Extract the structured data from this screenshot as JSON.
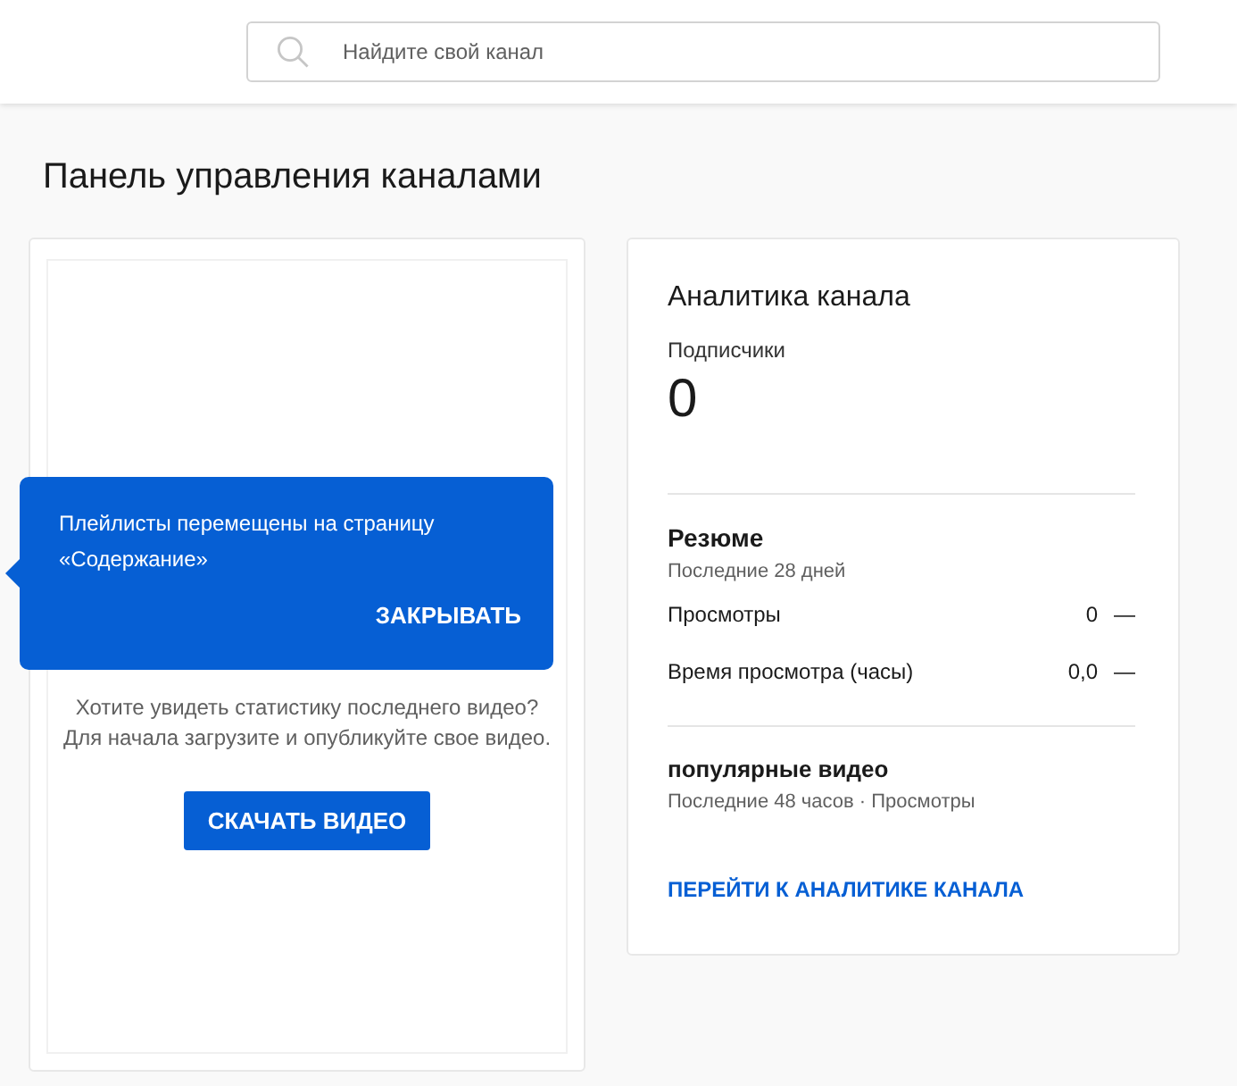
{
  "search": {
    "placeholder": "Найдите свой канал"
  },
  "page_title": "Панель управления каналами",
  "video_card": {
    "tooltip": {
      "text": "Плейлисты перемещены на страницу «Содержание»",
      "close_label": "ЗАКРЫВАТЬ"
    },
    "message_lines": [
      "Хотите увидеть статистику последнего видео?",
      "Для начала загрузите и опубликуйте свое видео."
    ],
    "button": "СКАЧАТЬ ВИДЕО"
  },
  "analytics": {
    "title": "Аналитика канала",
    "subscribers_label": "Подписчики",
    "subscribers_value": "0",
    "summary": {
      "title": "Резюме",
      "period": "Последние 28 дней",
      "metrics": [
        {
          "label": "Просмотры",
          "value": "0",
          "trend": "—"
        },
        {
          "label": "Время просмотра (часы)",
          "value": "0,0",
          "trend": "—"
        }
      ]
    },
    "popular": {
      "title": "популярные видео",
      "subtitle": "Последние 48 часов · Просмотры"
    },
    "link": "ПЕРЕЙТИ К АНАЛИТИКЕ КАНАЛА"
  }
}
